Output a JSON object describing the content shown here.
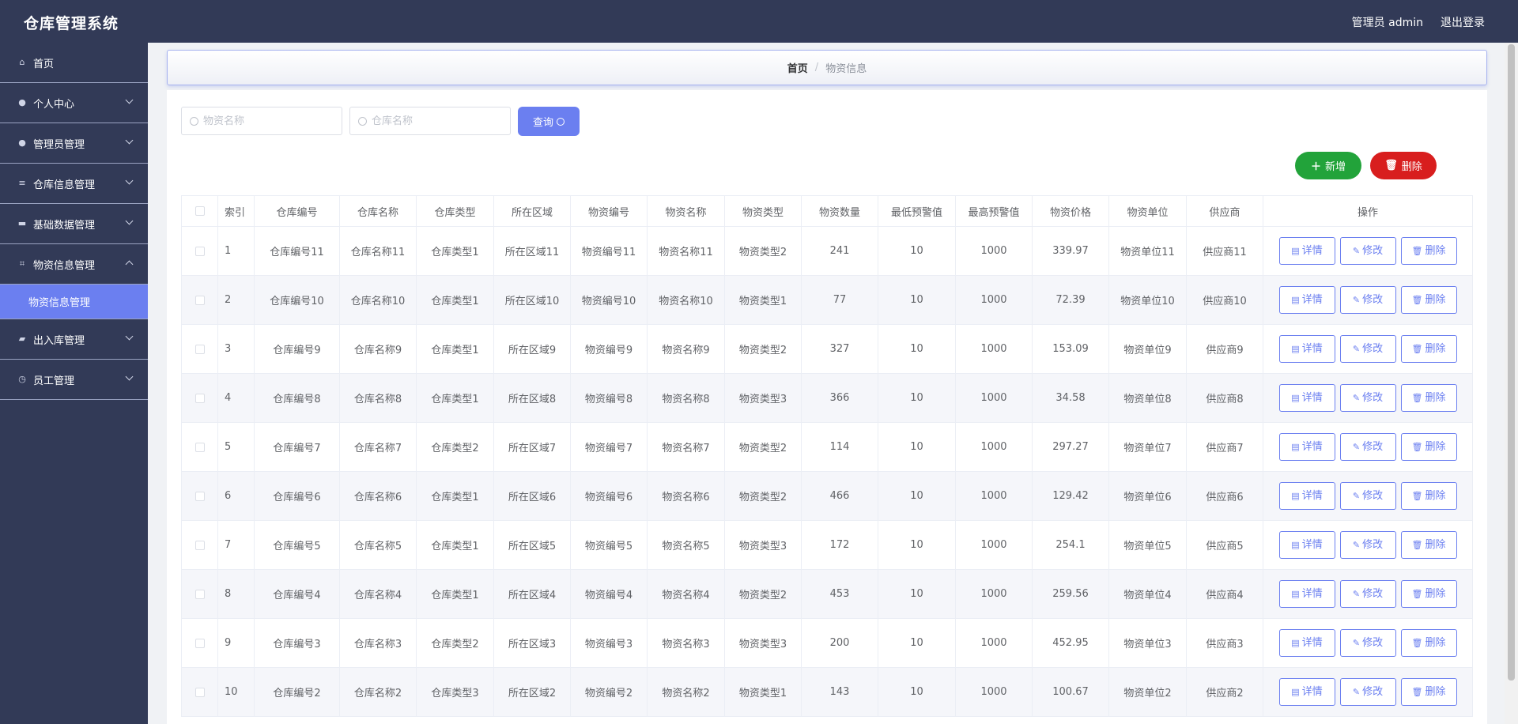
{
  "header": {
    "title": "仓库管理系统",
    "user": "管理员 admin",
    "logout": "退出登录"
  },
  "sidebar": {
    "items": [
      {
        "label": "首页",
        "icon": "home-icon"
      },
      {
        "label": "个人中心",
        "icon": "user-icon"
      },
      {
        "label": "管理员管理",
        "icon": "user-icon"
      },
      {
        "label": "仓库信息管理",
        "icon": "list-icon"
      },
      {
        "label": "基础数据管理",
        "icon": "chat-icon"
      },
      {
        "label": "物资信息管理",
        "icon": "crop-icon"
      },
      {
        "label": "出入库管理",
        "icon": "truck-icon"
      },
      {
        "label": "员工管理",
        "icon": "clock-icon"
      }
    ],
    "subitem": "物资信息管理"
  },
  "breadcrumb": {
    "home": "首页",
    "sep": "/",
    "current": "物资信息"
  },
  "search": {
    "material_placeholder": "物资名称",
    "warehouse_placeholder": "仓库名称",
    "query_label": "查询"
  },
  "actions": {
    "add_label": "新增",
    "delete_label": "删除"
  },
  "table": {
    "headers": [
      "索引",
      "仓库编号",
      "仓库名称",
      "仓库类型",
      "所在区域",
      "物资编号",
      "物资名称",
      "物资类型",
      "物资数量",
      "最低预警值",
      "最高预警值",
      "物资价格",
      "物资单位",
      "供应商",
      "操作"
    ],
    "op_labels": {
      "detail": "详情",
      "edit": "修改",
      "delete": "删除"
    },
    "rows": [
      [
        "1",
        "仓库编号11",
        "仓库名称11",
        "仓库类型1",
        "所在区域11",
        "物资编号11",
        "物资名称11",
        "物资类型2",
        "241",
        "10",
        "1000",
        "339.97",
        "物资单位11",
        "供应商11"
      ],
      [
        "2",
        "仓库编号10",
        "仓库名称10",
        "仓库类型1",
        "所在区域10",
        "物资编号10",
        "物资名称10",
        "物资类型1",
        "77",
        "10",
        "1000",
        "72.39",
        "物资单位10",
        "供应商10"
      ],
      [
        "3",
        "仓库编号9",
        "仓库名称9",
        "仓库类型1",
        "所在区域9",
        "物资编号9",
        "物资名称9",
        "物资类型2",
        "327",
        "10",
        "1000",
        "153.09",
        "物资单位9",
        "供应商9"
      ],
      [
        "4",
        "仓库编号8",
        "仓库名称8",
        "仓库类型1",
        "所在区域8",
        "物资编号8",
        "物资名称8",
        "物资类型3",
        "366",
        "10",
        "1000",
        "34.58",
        "物资单位8",
        "供应商8"
      ],
      [
        "5",
        "仓库编号7",
        "仓库名称7",
        "仓库类型2",
        "所在区域7",
        "物资编号7",
        "物资名称7",
        "物资类型2",
        "114",
        "10",
        "1000",
        "297.27",
        "物资单位7",
        "供应商7"
      ],
      [
        "6",
        "仓库编号6",
        "仓库名称6",
        "仓库类型1",
        "所在区域6",
        "物资编号6",
        "物资名称6",
        "物资类型2",
        "466",
        "10",
        "1000",
        "129.42",
        "物资单位6",
        "供应商6"
      ],
      [
        "7",
        "仓库编号5",
        "仓库名称5",
        "仓库类型1",
        "所在区域5",
        "物资编号5",
        "物资名称5",
        "物资类型3",
        "172",
        "10",
        "1000",
        "254.1",
        "物资单位5",
        "供应商5"
      ],
      [
        "8",
        "仓库编号4",
        "仓库名称4",
        "仓库类型1",
        "所在区域4",
        "物资编号4",
        "物资名称4",
        "物资类型2",
        "453",
        "10",
        "1000",
        "259.56",
        "物资单位4",
        "供应商4"
      ],
      [
        "9",
        "仓库编号3",
        "仓库名称3",
        "仓库类型2",
        "所在区域3",
        "物资编号3",
        "物资名称3",
        "物资类型3",
        "200",
        "10",
        "1000",
        "452.95",
        "物资单位3",
        "供应商3"
      ],
      [
        "10",
        "仓库编号2",
        "仓库名称2",
        "仓库类型3",
        "所在区域2",
        "物资编号2",
        "物资名称2",
        "物资类型1",
        "143",
        "10",
        "1000",
        "100.67",
        "物资单位2",
        "供应商2"
      ]
    ]
  },
  "colors": {
    "header_bg": "#323a57",
    "accent": "#6b7ff0",
    "add": "#22a33a",
    "delete": "#d81e1e"
  }
}
